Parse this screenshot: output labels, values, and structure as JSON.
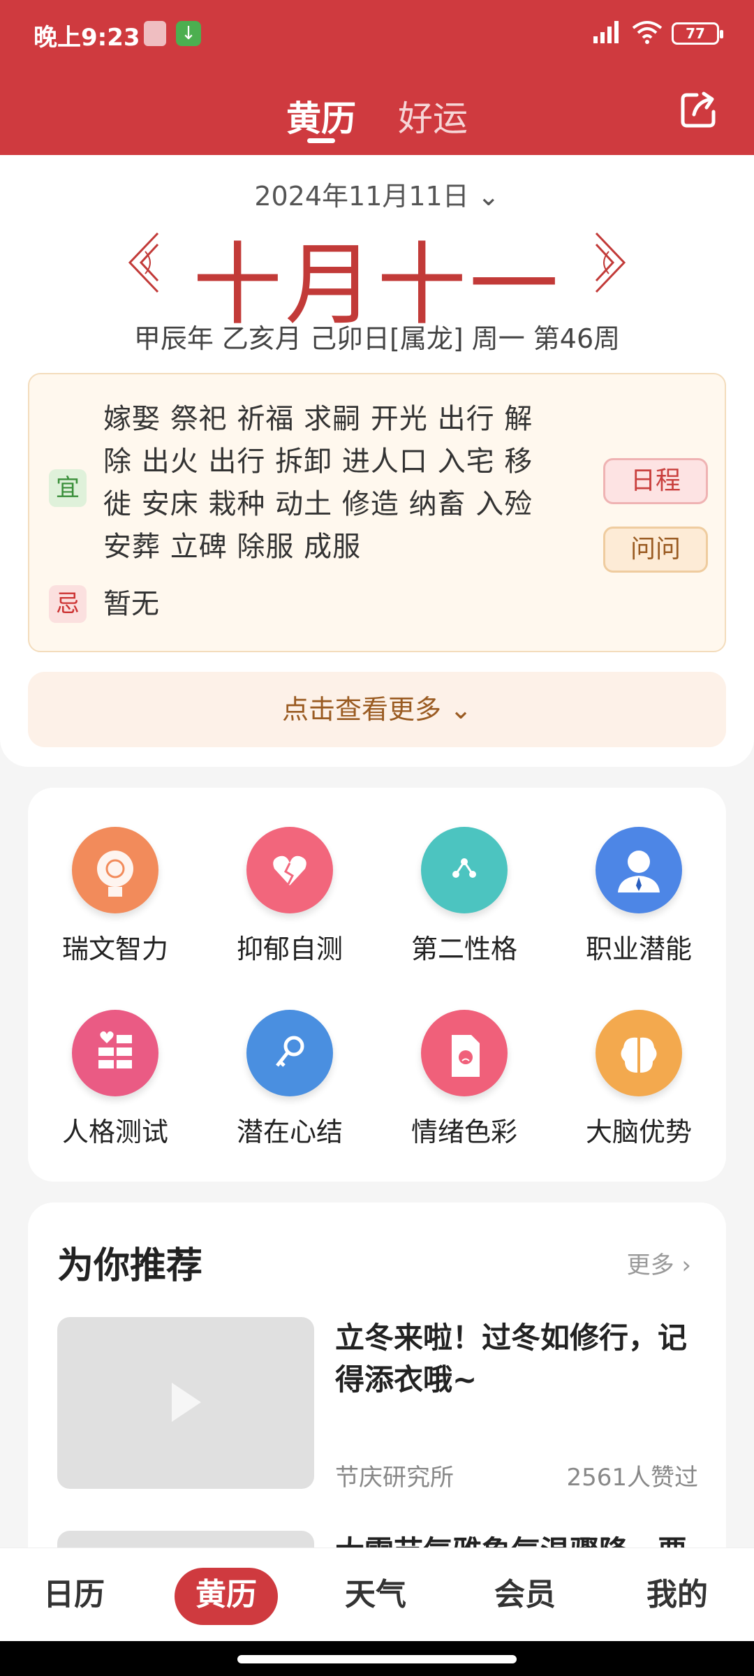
{
  "status_bar": {
    "time": "晚上9:23",
    "battery": "77"
  },
  "header": {
    "tabs": [
      "黄历",
      "好运"
    ],
    "active_tab": 0
  },
  "calendar": {
    "date_selector": "2024年11月11日",
    "lunar_date": "十月十一",
    "ganzhi": "甲辰年 乙亥月 己卯日[属龙] 周一 第46周"
  },
  "yiji": {
    "yi_label": "宜",
    "yi_lines": [
      "嫁娶 祭祀 祈福 求嗣 开光 出行 解",
      "除 出火 出行 拆卸 进人口 入宅 移",
      "徙 安床 栽种 动土 修造 纳畜 入殓",
      "安葬 立碑 除服 成服"
    ],
    "ji_label": "忌",
    "ji_text": "暂无",
    "schedule_button": "日程",
    "ask_button": "问问"
  },
  "more_bar": {
    "label": "点击查看更多"
  },
  "tools": [
    {
      "label": "瑞文智力",
      "icon": "brain-head-icon",
      "color": "#f28b5b"
    },
    {
      "label": "抑郁自测",
      "icon": "broken-heart-head-icon",
      "color": "#f2667c"
    },
    {
      "label": "第二性格",
      "icon": "network-head-icon",
      "color": "#4cc4c0"
    },
    {
      "label": "职业潜能",
      "icon": "businessman-icon",
      "color": "#4d86e6"
    },
    {
      "label": "人格测试",
      "icon": "heart-blocks-icon",
      "color": "#ea5b84"
    },
    {
      "label": "潜在心结",
      "icon": "key-head-icon",
      "color": "#4a8fe0"
    },
    {
      "label": "情绪色彩",
      "icon": "sad-document-icon",
      "color": "#f0607a"
    },
    {
      "label": "大脑优势",
      "icon": "brain-icon",
      "color": "#f3a94e"
    }
  ],
  "recommend": {
    "title": "为你推荐",
    "more": "更多",
    "articles": [
      {
        "title": "立冬来啦！过冬如修行，记得添衣哦~",
        "source": "节庆研究所",
        "likes": "2561人赞过"
      },
      {
        "title": "大雪节气雅象气温骤降，要"
      }
    ]
  },
  "bottom_nav": {
    "items": [
      "日历",
      "黄历",
      "天气",
      "会员",
      "我的"
    ],
    "active": 1
  },
  "colors": {
    "primary": "#cf3a3f",
    "lunar": "#c23a38",
    "accent_brown": "#9a5b22"
  }
}
